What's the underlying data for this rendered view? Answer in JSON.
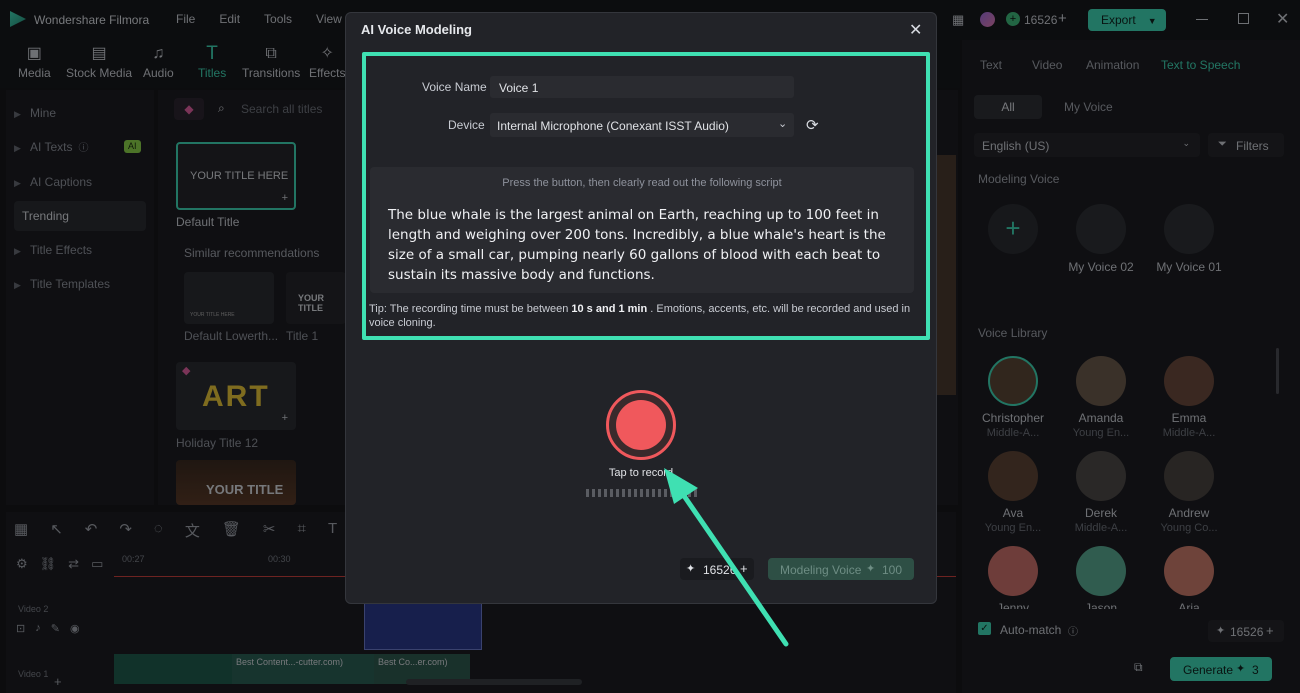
{
  "app": {
    "title": "Wondershare Filmora",
    "menu": [
      "File",
      "Edit",
      "Tools",
      "View"
    ],
    "credits": "16526",
    "export_label": "Export"
  },
  "toolbar": {
    "items": [
      "Media",
      "Stock Media",
      "Audio",
      "Titles",
      "Transitions",
      "Effects"
    ],
    "active": "Titles"
  },
  "left_panel": {
    "items": [
      "Mine",
      "AI Texts",
      "AI Captions",
      "Trending",
      "Title Effects",
      "Title Templates"
    ],
    "ai_badge": "AI",
    "selected": "Trending"
  },
  "center": {
    "search_placeholder": "Search all titles",
    "default_thumb_text": "YOUR TITLE HERE",
    "default_label": "Default Title",
    "similar_heading": "Similar recommendations",
    "rec1_label": "Default Lowerth...",
    "rec2_label": "Title 1",
    "rec2_thumb_text": "YOUR TITLE",
    "holiday_thumb_text": "ART",
    "holiday_label": "Holiday Title 12",
    "next_thumb_text": "YOUR TITLE"
  },
  "right_panel": {
    "tabs": [
      "Text",
      "Video",
      "Animation",
      "Text to Speech"
    ],
    "active_tab": "Text to Speech",
    "filter_tabs": [
      "All",
      "My Voice"
    ],
    "language": "English (US)",
    "filters_label": "Filters",
    "modeling_heading": "Modeling Voice",
    "my_voices": [
      "My Voice 02",
      "My Voice 01"
    ],
    "library_heading": "Voice Library",
    "voices": [
      {
        "name": "Christopher",
        "sub": "Middle-A..."
      },
      {
        "name": "Amanda",
        "sub": "Young En..."
      },
      {
        "name": "Emma",
        "sub": "Middle-A..."
      },
      {
        "name": "Ava",
        "sub": "Young En..."
      },
      {
        "name": "Derek",
        "sub": "Middle-A..."
      },
      {
        "name": "Andrew",
        "sub": "Young Co..."
      },
      {
        "name": "Jenny",
        "sub": ""
      },
      {
        "name": "Jason",
        "sub": ""
      },
      {
        "name": "Aria",
        "sub": ""
      }
    ],
    "automatch_label": "Auto-match",
    "credits": "16526",
    "generate_label": "Generate",
    "generate_cost": "3"
  },
  "timeline": {
    "times": [
      "00:27",
      "00:30"
    ],
    "track_label": "Video 2",
    "track_label2": "Video 1",
    "clip1": "Best Content...-cutter.com)",
    "clip2": "Best Co...er.com)"
  },
  "dialog": {
    "title": "AI Voice Modeling",
    "voice_name_label": "Voice Name",
    "voice_name_value": "Voice 1",
    "device_label": "Device",
    "device_value": "Internal Microphone (Conexant ISST Audio)",
    "instruction": "Press the button, then clearly read out the following script",
    "script": "The blue whale is the largest animal on Earth, reaching up to 100 feet in length and weighing over 200 tons. Incredibly, a blue whale's heart is the size of a small car, pumping nearly 60 gallons of blood with each beat to sustain its massive body and functions.",
    "tip_prefix": "Tip: The recording time must be between ",
    "tip_bold": "10 s and 1 min",
    "tip_suffix": " . Emotions, accents, etc. will be recorded and used in voice cloning.",
    "record_label": "Tap to record",
    "credits": "16526",
    "modeling_button": "Modeling Voice",
    "modeling_cost": "100"
  },
  "colors": {
    "accent": "#3fd6b4",
    "highlight": "#3fe0b2",
    "record": "#f0585c"
  }
}
